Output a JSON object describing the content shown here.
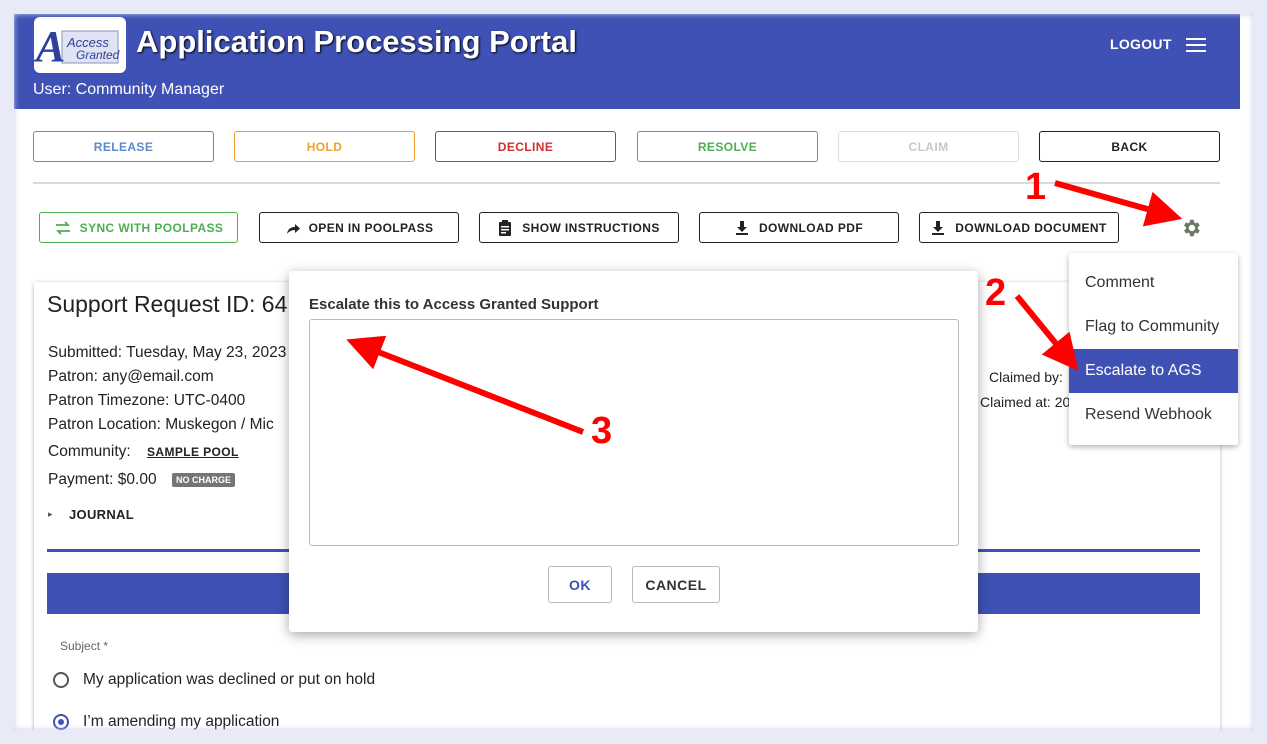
{
  "header": {
    "logo_text_top": "Access",
    "logo_text_bottom": "Granted",
    "title": "Application Processing Portal",
    "user": "User: Community Manager",
    "logout": "LOGOUT"
  },
  "action_buttons": [
    {
      "label": "RELEASE",
      "color": "#5b8cc8"
    },
    {
      "label": "HOLD",
      "color": "#f0a030"
    },
    {
      "label": "DECLINE",
      "color": "#d32f2f"
    },
    {
      "label": "RESOLVE",
      "color": "#4caf50"
    },
    {
      "label": "CLAIM",
      "color": "#c8c8c8"
    },
    {
      "label": "BACK",
      "color": "#222222"
    }
  ],
  "tool_buttons": {
    "sync": "SYNC WITH POOLPASS",
    "open": "OPEN IN POOLPASS",
    "instructions": "SHOW INSTRUCTIONS",
    "pdf": "DOWNLOAD PDF",
    "document": "DOWNLOAD DOCUMENT"
  },
  "request": {
    "id_label": "Support Request ID:",
    "id_value": "64",
    "submitted": "Submitted: Tuesday, May 23, 2023",
    "patron": "Patron: any@email.com",
    "timezone": "Patron Timezone: UTC-0400",
    "location": "Patron Location: Muskegon / Mic",
    "community_label": "Community:",
    "community_value": "SAMPLE POOL",
    "payment": "Payment: $0.00",
    "payment_badge": "NO CHARGE",
    "journal": "JOURNAL",
    "claimed_by": "Claimed by:",
    "claimed_at": "Claimed at: 20",
    "subject_label": "Subject *",
    "options": [
      {
        "label": "My application was declined or put on hold",
        "checked": false
      },
      {
        "label": "I’m amending my application",
        "checked": true
      }
    ]
  },
  "settings_menu": {
    "items": [
      "Comment",
      "Flag to Community",
      "Escalate to AGS",
      "Resend Webhook"
    ],
    "active_index": 2
  },
  "dialog": {
    "title": "Escalate this to Access Granted Support",
    "textarea_value": "",
    "ok": "OK",
    "cancel": "CANCEL"
  },
  "annotations": {
    "one": "1",
    "two": "2",
    "three": "3",
    "color": "#ff0000"
  },
  "colors": {
    "primary": "#3f51b5"
  }
}
